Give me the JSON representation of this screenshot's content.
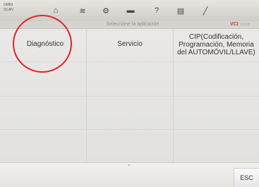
{
  "topbar": {
    "brand_line1": "OMNI",
    "brand_line2": "SCAN",
    "tools": [
      {
        "icon": "home-icon",
        "glyph": "⌂"
      },
      {
        "icon": "vehicle-lift-icon",
        "glyph": "≋"
      },
      {
        "icon": "gear-icon",
        "glyph": "⚙"
      },
      {
        "icon": "printer-icon",
        "glyph": "▬"
      },
      {
        "icon": "help-icon",
        "glyph": "?"
      },
      {
        "icon": "save-icon",
        "glyph": "▤"
      },
      {
        "icon": "pen-icon",
        "glyph": "╱"
      }
    ]
  },
  "header": {
    "subtitle": "Seleccione la aplicación",
    "vci_label": "VCI",
    "battery_label": "▭▭"
  },
  "options": {
    "diagnostico": "Diagnóstico",
    "servicio": "Servicio",
    "cip_line1": "CIP(Codificación,",
    "cip_line2": "Programación, Memoria",
    "cip_line3": "del AUTOMÓVIL/LLAVE)"
  },
  "footer": {
    "esc_label": "ESC"
  },
  "colors": {
    "highlight_circle": "#e0242a",
    "vci_accent": "#c23a2d"
  }
}
